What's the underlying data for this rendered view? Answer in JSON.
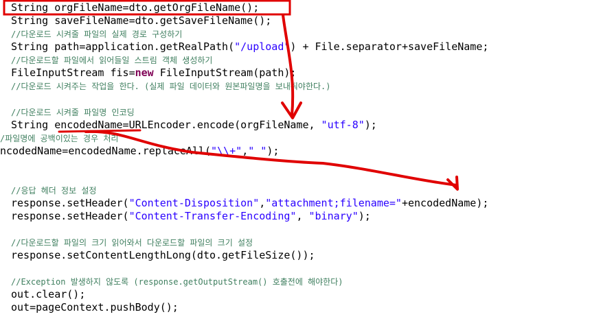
{
  "editor": {
    "lines": [
      {
        "segments": [
          {
            "t": "String orgFileName=dto.getOrgFileName();"
          }
        ]
      },
      {
        "segments": [
          {
            "t": "String saveFileName=dto.getSaveFileName();"
          }
        ]
      },
      {
        "segments": [
          {
            "t": "//다운로드 시켜줄 파일의 실제 경로 구성하기",
            "c": "cmt"
          }
        ]
      },
      {
        "segments": [
          {
            "t": "String path=application.getRealPath("
          },
          {
            "t": "\"/upload\"",
            "c": "str"
          },
          {
            "t": ") + File.separator+saveFileName;"
          }
        ]
      },
      {
        "segments": [
          {
            "t": "//다운로드할 파일에서 읽어들일 스트림 객체 생성하기",
            "c": "cmt"
          }
        ]
      },
      {
        "segments": [
          {
            "t": "FileInputStream fis="
          },
          {
            "t": "new",
            "c": "kw"
          },
          {
            "t": " FileInputStream(path);"
          }
        ]
      },
      {
        "segments": [
          {
            "t": "//다운로드 시켜주는 작업을 한다. (실제 파일 데이터와 원본파일명을 보내줘야한다.)",
            "c": "cmt"
          }
        ]
      },
      {
        "segments": []
      },
      {
        "segments": [
          {
            "t": "//다운로드 시켜줄 파일명 인코딩",
            "c": "cmt"
          }
        ]
      },
      {
        "segments": [
          {
            "t": "String encodedName=URLEncoder.encode(orgFileName, "
          },
          {
            "t": "\"utf-8\"",
            "c": "str"
          },
          {
            "t": ");"
          }
        ]
      },
      {
        "segments": [
          {
            "t": "/파일명에 공백이있는 경우 처리",
            "c": "cmt"
          }
        ]
      },
      {
        "segments": [
          {
            "t": "ncodedName=encodedName.replaceAll("
          },
          {
            "t": "\"\\\\+\"",
            "c": "str"
          },
          {
            "t": ","
          },
          {
            "t": "\" \"",
            "c": "str"
          },
          {
            "t": ");"
          }
        ]
      },
      {
        "segments": []
      },
      {
        "segments": []
      },
      {
        "segments": [
          {
            "t": "//응답 헤더 정보 설정",
            "c": "cmt"
          }
        ]
      },
      {
        "segments": [
          {
            "t": "response.setHeader("
          },
          {
            "t": "\"Content-Disposition\"",
            "c": "str"
          },
          {
            "t": ","
          },
          {
            "t": "\"attachment;filename=\"",
            "c": "str"
          },
          {
            "t": "+encodedName);"
          }
        ]
      },
      {
        "segments": [
          {
            "t": "response.setHeader("
          },
          {
            "t": "\"Content-Transfer-Encoding\"",
            "c": "str"
          },
          {
            "t": ", "
          },
          {
            "t": "\"binary\"",
            "c": "str"
          },
          {
            "t": ");"
          }
        ]
      },
      {
        "segments": []
      },
      {
        "segments": [
          {
            "t": "//다운로드할 파일의 크기 읽어와서 다운로드할 파일의 크기 설정",
            "c": "cmt"
          }
        ]
      },
      {
        "segments": [
          {
            "t": "response.setContentLengthLong(dto.getFileSize());"
          }
        ]
      },
      {
        "segments": []
      },
      {
        "segments": [
          {
            "t": "//Exception 발생하지 않도록 (response.getOutputStream() 호출전에 해야한다)",
            "c": "cmt"
          }
        ]
      },
      {
        "segments": [
          {
            "t": "out.clear();"
          }
        ]
      },
      {
        "segments": [
          {
            "t": "out=pageContext.pushBody();"
          }
        ]
      }
    ]
  },
  "colors": {
    "background": "#ffffff",
    "code": "#000000",
    "comment": "#3f7f5f",
    "string": "#2a00ff",
    "keyword": "#7f0055",
    "annotation": "#e00000"
  },
  "annotations": {
    "highlight_box": "red-rectangle",
    "arrow_1": "red-arrow-down",
    "arrow_2": "red-arrow-right",
    "underline": "red-underline"
  }
}
